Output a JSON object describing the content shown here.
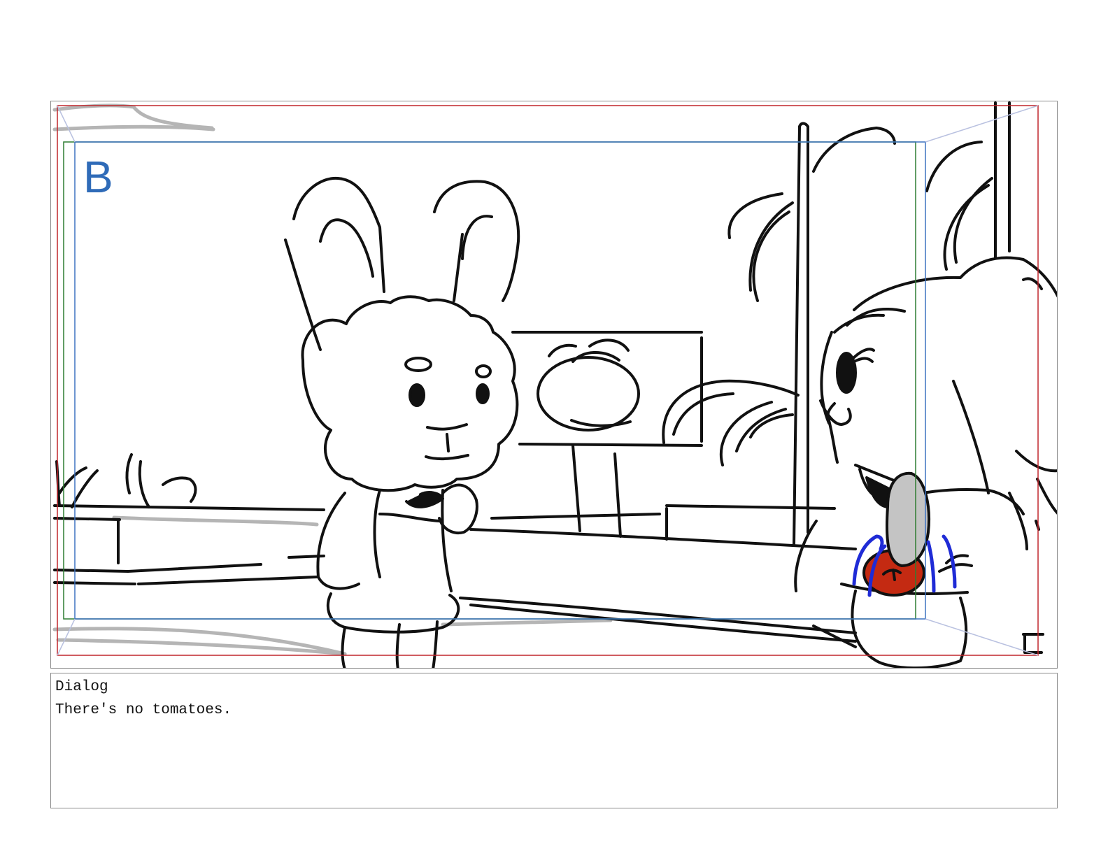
{
  "panel": {
    "letter": "B",
    "frame_colors": {
      "border": "#8a8a8a",
      "action_safe": "#c0262c",
      "title_safe": "#3d72c0",
      "safe_green": "#2e7d32",
      "accent_blue": "#1f2bd6",
      "tomato_red": "#c42a12",
      "bottle_gray": "#c4c4c4"
    },
    "scene": {
      "characters": [
        "bunny-character",
        "elephant-character"
      ],
      "props": [
        "cabbage-sign",
        "shop-counter",
        "basket-with-tomato"
      ]
    }
  },
  "dialog": {
    "label": "Dialog",
    "text": "There's no tomatoes."
  }
}
